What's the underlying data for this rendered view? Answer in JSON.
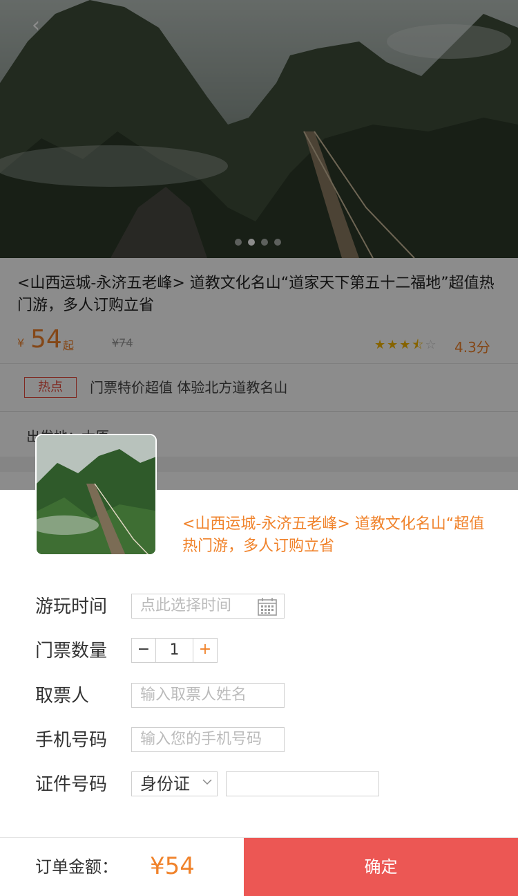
{
  "background_page": {
    "title": "<山西运城-永济五老峰> 道教文化名山“道家天下第五十二福地”超值热门游，多人订购立省",
    "price_symbol": "¥",
    "price": "54",
    "price_suffix": "起",
    "original_price": "¥74",
    "rating_stars": 3.5,
    "rating_text": "4.3分",
    "hot_tag": "热点",
    "hot_text": "门票特价超值 体验北方道教名山",
    "departure": "出发地：太原",
    "carousel_pages": 4,
    "carousel_active": 1
  },
  "booking": {
    "product_title": "<山西运城-永济五老峰> 道教文化名山“超值热门游，多人订购立省",
    "fields": {
      "visit_time_label": "游玩时间",
      "visit_time_placeholder": "点此选择时间",
      "ticket_qty_label": "门票数量",
      "ticket_qty_minus": "−",
      "ticket_qty_value": "1",
      "ticket_qty_plus": "+",
      "collector_label": "取票人",
      "collector_placeholder": "输入取票人姓名",
      "phone_label": "手机号码",
      "phone_placeholder": "输入您的手机号码",
      "id_label": "证件号码",
      "id_type": "身份证",
      "id_value": ""
    }
  },
  "footer": {
    "amount_label": "订单金额：",
    "amount": "¥54",
    "confirm_label": "确定"
  },
  "colors": {
    "accent_orange": "#f0822a",
    "confirm_red": "#ec5754",
    "tag_red": "#e84c3d"
  }
}
